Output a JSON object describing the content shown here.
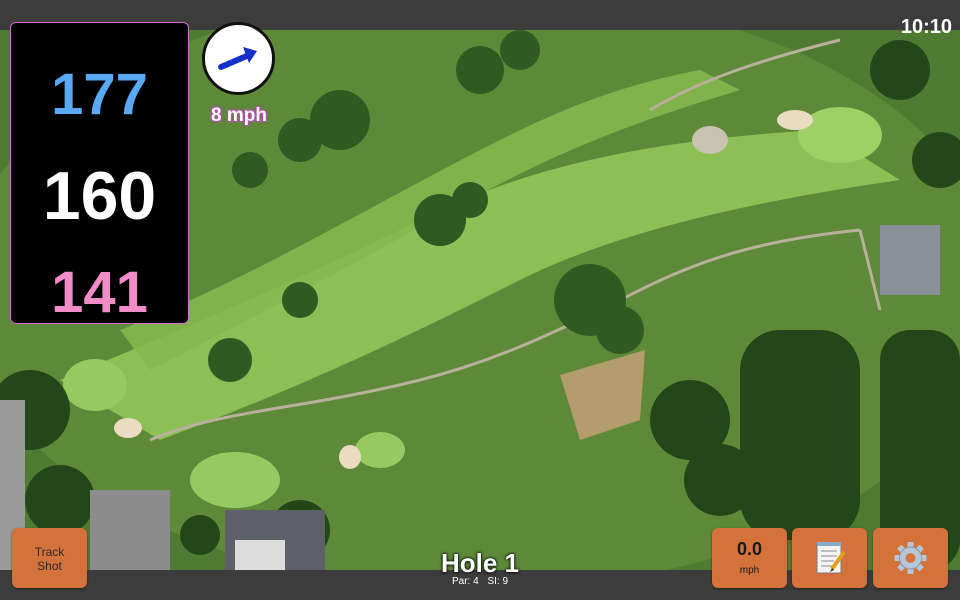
{
  "status_bar": {
    "time": "10:10"
  },
  "distances": {
    "back": "177",
    "middle": "160",
    "front": "141"
  },
  "wind": {
    "speed": "8 mph",
    "icon": "wind-arrow-icon"
  },
  "controls": {
    "track_shot_label": "Track\nShot",
    "speed_value": "0.0",
    "speed_unit": "mph",
    "notes_icon": "notepad-icon",
    "settings_icon": "gear-icon"
  },
  "hole": {
    "title": "Hole 1",
    "par": "Par: 4",
    "si": "SI: 9"
  },
  "colors": {
    "back": "#5aa9f5",
    "middle": "#ffffff",
    "front": "#f08cc8",
    "button": "#d4723c",
    "panel_border": "#d26bd2"
  }
}
